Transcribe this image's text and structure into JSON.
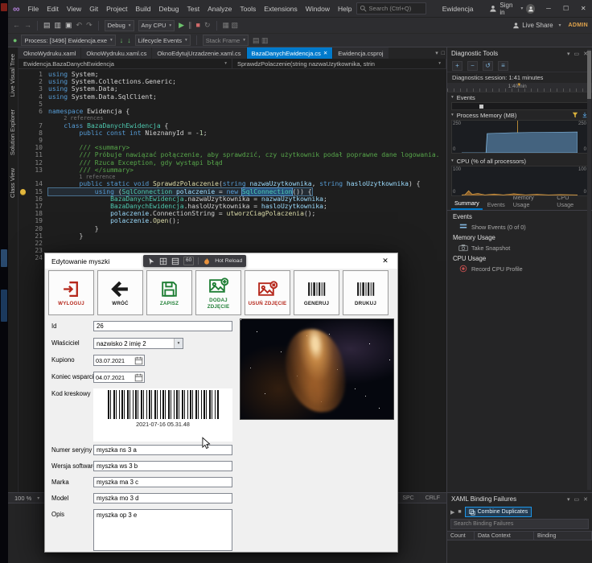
{
  "window": {
    "search_placeholder": "Search (Ctrl+Q)",
    "title": "Ewidencja",
    "sign_in": "Sign in",
    "live_share": "Live Share",
    "admin_badge": "ADMIN"
  },
  "menubar": {
    "items": [
      "File",
      "Edit",
      "View",
      "Git",
      "Project",
      "Build",
      "Debug",
      "Test",
      "Analyze",
      "Tools",
      "Extensions",
      "Window",
      "Help"
    ]
  },
  "toolbar": {
    "configuration": "Debug",
    "platform": "Any CPU",
    "process": "Process: [3496] Ewidencja.exe",
    "lifecycle": "Lifecycle Events",
    "stack_frame": "Stack Frame"
  },
  "side_tabs": {
    "items": [
      "Live Visual Tree",
      "Solution Explorer",
      "Class View"
    ]
  },
  "editor": {
    "tabs": [
      {
        "label": "OknoWydruku.xaml",
        "active": false
      },
      {
        "label": "OknoWydruku.xaml.cs",
        "active": false
      },
      {
        "label": "OknoEdytujUrzadzenie.xaml.cs",
        "active": false
      },
      {
        "label": "BazaDanychEwidencja.cs",
        "active": true
      },
      {
        "label": "Ewidencja.csproj",
        "active": false
      }
    ],
    "breadcrumb": {
      "type": "Ewidencja.BazaDanychEwidencja",
      "member": "SprawdzPolaczenie(string nazwaUzytkownika, strin"
    },
    "status": {
      "zoom": "100 %",
      "space": "SPC",
      "eol": "CRLF"
    }
  },
  "code": {
    "lines": [
      {
        "n": "1",
        "seg": [
          [
            "k",
            "using "
          ],
          [
            "p",
            "System;"
          ]
        ]
      },
      {
        "n": "2",
        "seg": [
          [
            "k",
            "using "
          ],
          [
            "p",
            "System.Collections.Generic;"
          ]
        ]
      },
      {
        "n": "3",
        "seg": [
          [
            "k",
            "using "
          ],
          [
            "p",
            "System.Data;"
          ]
        ]
      },
      {
        "n": "4",
        "seg": [
          [
            "k",
            "using "
          ],
          [
            "p",
            "System.Data.SqlClient;"
          ]
        ]
      },
      {
        "n": "5",
        "seg": []
      },
      {
        "n": "6",
        "seg": [
          [
            "k",
            "namespace "
          ],
          [
            "p",
            "Ewidencja {"
          ]
        ]
      },
      {
        "lens": "2 references",
        "pad": "    "
      },
      {
        "n": "7",
        "seg": [
          [
            "p",
            "    "
          ],
          [
            "k",
            "class "
          ],
          [
            "t",
            "BazaDanychEwidencja"
          ],
          [
            "p",
            " {"
          ]
        ]
      },
      {
        "n": "8",
        "seg": [
          [
            "p",
            "        "
          ],
          [
            "k",
            "public const int "
          ],
          [
            "p",
            "NieznanyId = -"
          ],
          [
            "num",
            "1"
          ],
          [
            "p",
            ";"
          ]
        ]
      },
      {
        "n": "9",
        "seg": []
      },
      {
        "n": "10",
        "seg": [
          [
            "c",
            "        /// <summary>"
          ]
        ]
      },
      {
        "n": "11",
        "seg": [
          [
            "c",
            "        /// Próbuje nawiązać połączenie, aby sprawdzić, czy użytkownik podał poprawne dane logowania."
          ]
        ]
      },
      {
        "n": "12",
        "seg": [
          [
            "c",
            "        /// Rzuca Exception, gdy wystąpi błąd"
          ]
        ]
      },
      {
        "n": "13",
        "seg": [
          [
            "c",
            "        /// </summary>"
          ]
        ]
      },
      {
        "lens": "1 reference",
        "pad": "        "
      },
      {
        "n": "14",
        "seg": [
          [
            "p",
            "        "
          ],
          [
            "k",
            "public static void "
          ],
          [
            "m",
            "SprawdzPolaczenie"
          ],
          [
            "p",
            "("
          ],
          [
            "k",
            "string"
          ],
          [
            "v",
            " nazwaUzytkownika"
          ],
          [
            "p",
            ", "
          ],
          [
            "k",
            "string"
          ],
          [
            "v",
            " hasloUzytkownika"
          ],
          [
            "p",
            ") {"
          ]
        ]
      },
      {
        "n": "15",
        "hl": true,
        "bulb": true,
        "seg": [
          [
            "p",
            "            "
          ],
          [
            "k",
            "using "
          ],
          [
            "p",
            "("
          ],
          [
            "t",
            "SqlConnection"
          ],
          [
            "v",
            " polaczenie"
          ],
          [
            "p",
            " = "
          ],
          [
            "k",
            "new "
          ],
          [
            "t sel",
            "SqlConnection"
          ],
          [
            "p",
            "()) {"
          ]
        ]
      },
      {
        "n": "16",
        "seg": [
          [
            "p",
            "                "
          ],
          [
            "t",
            "BazaDanychEwidencja"
          ],
          [
            "p",
            ".nazwaUzytkownika ="
          ],
          [
            "v",
            " nazwaUzytkownika"
          ],
          [
            "p",
            ";"
          ]
        ]
      },
      {
        "n": "17",
        "seg": [
          [
            "p",
            "                "
          ],
          [
            "t",
            "BazaDanychEwidencja"
          ],
          [
            "p",
            ".hasloUzytkownika ="
          ],
          [
            "v",
            " hasloUzytkownika"
          ],
          [
            "p",
            ";"
          ]
        ]
      },
      {
        "n": "18",
        "seg": [
          [
            "p",
            "                "
          ],
          [
            "v",
            "polaczenie"
          ],
          [
            "p",
            ".ConnectionString = "
          ],
          [
            "m",
            "utworzCiagPolaczenia"
          ],
          [
            "p",
            "();"
          ]
        ]
      },
      {
        "n": "19",
        "seg": [
          [
            "p",
            "                "
          ],
          [
            "v",
            "polaczenie"
          ],
          [
            "p",
            "."
          ],
          [
            "m",
            "Open"
          ],
          [
            "p",
            "();"
          ]
        ]
      },
      {
        "n": "20",
        "seg": [
          [
            "p",
            "            }"
          ]
        ]
      },
      {
        "n": "21",
        "seg": [
          [
            "p",
            "        }"
          ]
        ]
      },
      {
        "n": "22",
        "seg": []
      },
      {
        "n": "23",
        "seg": []
      },
      {
        "n": "24",
        "seg": []
      }
    ]
  },
  "diagnostics": {
    "title": "Diagnostic Tools",
    "session_label": "Diagnostics session: 1:41 minutes",
    "time_marker": "1:40min",
    "events_section": "Events",
    "memory_section": "Process Memory (MB)",
    "cpu_section": "CPU (% of all processors)",
    "tabs": [
      {
        "label": "Summary",
        "active": true
      },
      {
        "label": "Events",
        "active": false
      },
      {
        "label": "Memory Usage",
        "active": false
      },
      {
        "label": "CPU Usage",
        "active": false
      }
    ],
    "summary_rows": [
      {
        "header": "Events"
      },
      {
        "item": "Show Events (0 of 0)",
        "icon": "show-events-icon"
      },
      {
        "header": "Memory Usage"
      },
      {
        "item": "Take Snapshot",
        "icon": "camera-icon"
      },
      {
        "header": "CPU Usage"
      },
      {
        "item": "Record CPU Profile",
        "icon": "record-icon"
      }
    ],
    "charts": {
      "memory": {
        "type": "area",
        "ylabel_max": "250",
        "ylabel_min": "0",
        "max": 250,
        "color": "#44637f",
        "stroke": "#7fb2d9",
        "points": [
          [
            0,
            0
          ],
          [
            0.21,
            0
          ],
          [
            0.22,
            150
          ],
          [
            0.4,
            155
          ],
          [
            0.6,
            158
          ],
          [
            0.8,
            160
          ],
          [
            1,
            162
          ]
        ]
      },
      "cpu": {
        "type": "area",
        "ylabel_max": "100",
        "ylabel_min": "0",
        "max": 100,
        "color": "#8a5e28",
        "stroke": "#d8a04b",
        "points": [
          [
            0,
            2
          ],
          [
            0.03,
            3
          ],
          [
            0.06,
            16
          ],
          [
            0.09,
            4
          ],
          [
            0.14,
            7
          ],
          [
            0.2,
            2
          ],
          [
            0.28,
            5
          ],
          [
            0.36,
            2
          ],
          [
            0.45,
            6
          ],
          [
            0.55,
            2
          ],
          [
            0.65,
            4
          ],
          [
            0.75,
            2
          ],
          [
            0.85,
            3
          ],
          [
            1,
            2
          ]
        ]
      }
    }
  },
  "binding_failures": {
    "title": "XAML Binding Failures",
    "combine_button": "Combine Duplicates",
    "search_placeholder": "Search Binding Failures",
    "columns": [
      "Count",
      "Data Context",
      "Binding"
    ]
  },
  "dialog": {
    "title": "Edytowanie myszki",
    "overlay": {
      "fps": "60",
      "hot_reload": "Hot Reload"
    },
    "buttons": [
      {
        "label": "WYLOGUJ",
        "name": "wyloguj",
        "icon": "logout-icon",
        "shape": "logout",
        "color": "#b5271b"
      },
      {
        "label": "WRÓĆ",
        "name": "wroc",
        "icon": "back-arrow-icon",
        "shape": "back",
        "color": "#1a1a1a"
      },
      {
        "label": "ZAPISZ",
        "name": "zapisz",
        "icon": "save-floppy-icon",
        "shape": "save",
        "color": "#1e7e34"
      },
      {
        "label": "DODAJ ZDJĘCIE",
        "name": "dodaj-zdjecie",
        "icon": "add-photo-icon",
        "shape": "addphoto",
        "color": "#1e7e34"
      },
      {
        "label": "USUŃ ZDJĘCIE",
        "name": "usun-zdjecie",
        "icon": "remove-photo-icon",
        "shape": "delphoto",
        "color": "#b5271b"
      },
      {
        "label": "GENERUJ",
        "name": "generuj",
        "icon": "barcode-icon",
        "shape": "barcode",
        "color": "#1a1a1a"
      },
      {
        "label": "DRUKUJ",
        "name": "drukuj",
        "icon": "barcode-icon",
        "shape": "barcode",
        "color": "#1a1a1a"
      }
    ],
    "fields": [
      {
        "label": "Id",
        "name": "id",
        "type": "text",
        "value": "26"
      },
      {
        "label": "Właściciel",
        "name": "wlasciciel",
        "type": "select",
        "value": "nazwisko 2 imię 2"
      },
      {
        "label": "Kupiono",
        "name": "kupiono",
        "type": "date",
        "value": "03.07.2021"
      },
      {
        "label": "Koniec wsparcia",
        "name": "koniec-wsparcia",
        "type": "date",
        "value": "04.07.2021"
      },
      {
        "label": "Kod kreskowy",
        "name": "kod-kreskowy",
        "type": "barcode",
        "caption": "2021-07-16 05.31.48"
      },
      {
        "label": "Numer seryjny",
        "name": "numer-seryjny",
        "type": "text",
        "value": "myszka ns 3 a"
      },
      {
        "label": "Wersja software",
        "name": "wersja-software",
        "type": "text",
        "value": "myszka ws 3 b"
      },
      {
        "label": "Marka",
        "name": "marka",
        "type": "text",
        "value": "myszka ma 3 c"
      },
      {
        "label": "Model",
        "name": "model",
        "type": "text",
        "value": "myszka mo 3 d"
      },
      {
        "label": "Opis",
        "name": "opis",
        "type": "textarea",
        "value": "myszka op 3 e"
      }
    ]
  },
  "icons": {
    "search-icon": "magnifier",
    "person-icon": "person-silhouette",
    "chevron-down-icon": "▾",
    "minimize-icon": "─",
    "maximize-icon": "☐",
    "close-icon": "✕",
    "back-icon": "←",
    "forward-icon": "→",
    "play-icon": "▶",
    "pause-icon": "∥",
    "stop-icon": "■",
    "restart-icon": "↻",
    "undo-icon": "↶",
    "redo-icon": "↷",
    "funnel-icon": "funnel",
    "camera-icon": "camera",
    "record-icon": "record-circle",
    "hot-reload-flame-icon": "flame",
    "lightbulb-icon": "bulb",
    "calendar-icon": "calendar",
    "barcode-icon": "bars",
    "pin-icon": "▭"
  }
}
